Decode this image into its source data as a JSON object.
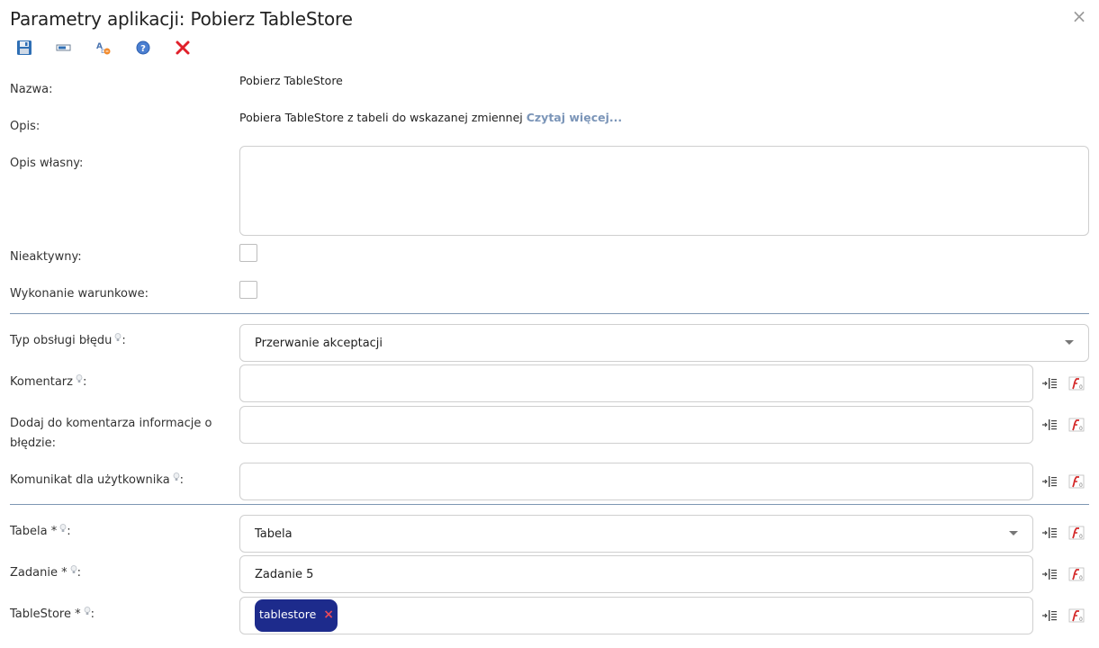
{
  "window": {
    "title": "Parametry aplikacji: Pobierz TableStore",
    "close_glyph": "×"
  },
  "toolbar": {
    "buttons": [
      {
        "name": "save-icon"
      },
      {
        "name": "field-icon"
      },
      {
        "name": "translate-icon"
      },
      {
        "name": "help-icon"
      },
      {
        "name": "delete-icon"
      }
    ]
  },
  "form": {
    "nazwa_label": "Nazwa:",
    "nazwa_value": "Pobierz TableStore",
    "opis_label": "Opis:",
    "opis_value": "Pobiera TableStore z tabeli do wskazanej zmiennej",
    "opis_read_more": "Czytaj więcej...",
    "opis_wlasny_label": "Opis własny:",
    "opis_wlasny_value": "",
    "nieaktywny_label": "Nieaktywny:",
    "nieaktywny_checked": false,
    "wykonanie_label": "Wykonanie warunkowe:",
    "wykonanie_checked": false,
    "typ_label": "Typ obsługi błędu",
    "typ_value": "Przerwanie akceptacji",
    "komentarz_label": "Komentarz",
    "komentarz_value": "",
    "dodaj_label_line1": "Dodaj do komentarza informacje o",
    "dodaj_label_line2": "błędzie:",
    "dodaj_value": "",
    "komunikat_label": "Komunikat dla użytkownika",
    "komunikat_value": "",
    "tabela_label": "Tabela",
    "tabela_value": "Tabela",
    "zadanie_label": "Zadanie",
    "zadanie_value": "Zadanie 5",
    "tablestore_label": "TableStore",
    "tablestore_chip": "tablestore",
    "required_mark": "*",
    "colon": ":"
  },
  "colors": {
    "divider": "#7e97b3",
    "chip_bg": "#1d2b8c",
    "chip_remove": "#e8495a",
    "read_more": "#7b95b8"
  }
}
